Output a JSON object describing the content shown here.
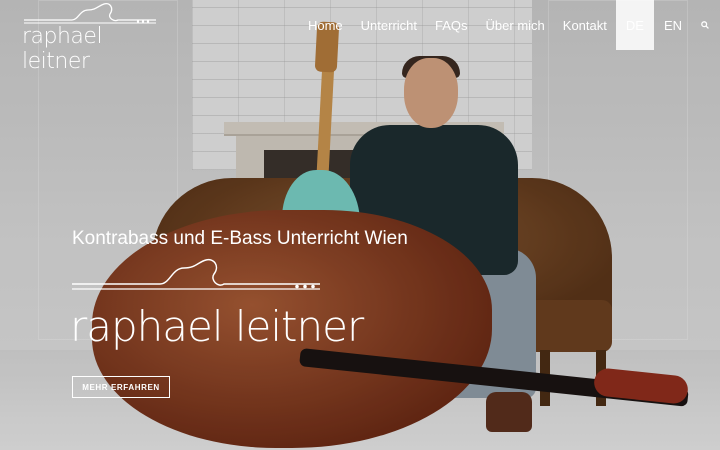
{
  "brand": {
    "logo_text": "raphael leitner"
  },
  "nav": {
    "items": [
      {
        "label": "Home"
      },
      {
        "label": "Unterricht"
      },
      {
        "label": "FAQs"
      },
      {
        "label": "Über mich"
      },
      {
        "label": "Kontakt"
      }
    ],
    "languages": [
      {
        "label": "DE",
        "active": true
      },
      {
        "label": "EN",
        "active": false
      }
    ],
    "search_icon": "search-icon"
  },
  "hero": {
    "subtitle": "Kontrabass und E-Bass Unterricht Wien",
    "brand_text": "raphael leitner",
    "cta_label": "MEHR ERFAHREN"
  },
  "colors": {
    "text": "#ffffff",
    "active_lang_bg": "#ffffff"
  }
}
